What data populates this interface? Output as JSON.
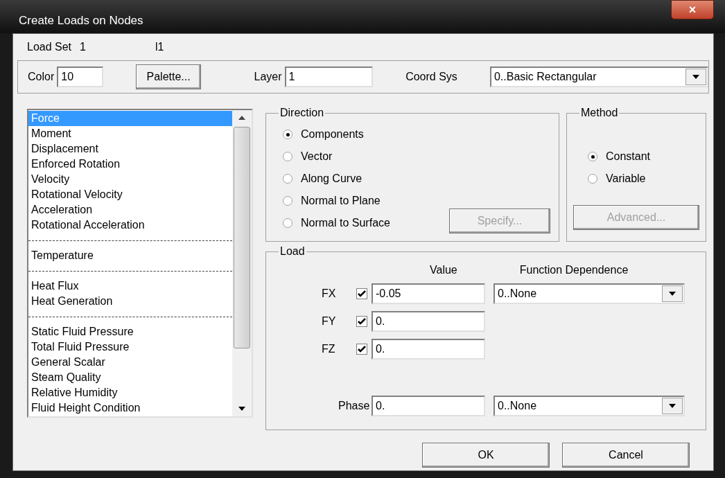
{
  "window": {
    "title": "Create Loads on Nodes",
    "close": "×"
  },
  "load_set": {
    "label": "Load Set",
    "number": "1",
    "name": "l1"
  },
  "top": {
    "color_label": "Color",
    "color_value": "10",
    "palette_button": "Palette...",
    "layer_label": "Layer",
    "layer_value": "1",
    "coord_label": "Coord Sys",
    "coord_value": "0..Basic Rectangular"
  },
  "load_types": [
    {
      "kind": "item",
      "label": "Force",
      "selected": true
    },
    {
      "kind": "item",
      "label": "Moment",
      "selected": false
    },
    {
      "kind": "item",
      "label": "Displacement",
      "selected": false
    },
    {
      "kind": "item",
      "label": "Enforced Rotation",
      "selected": false
    },
    {
      "kind": "item",
      "label": "Velocity",
      "selected": false
    },
    {
      "kind": "item",
      "label": "Rotational Velocity",
      "selected": false
    },
    {
      "kind": "item",
      "label": "Acceleration",
      "selected": false
    },
    {
      "kind": "item",
      "label": "Rotational Acceleration",
      "selected": false
    },
    {
      "kind": "separator"
    },
    {
      "kind": "item",
      "label": "Temperature",
      "selected": false
    },
    {
      "kind": "separator"
    },
    {
      "kind": "item",
      "label": "Heat Flux",
      "selected": false
    },
    {
      "kind": "item",
      "label": "Heat Generation",
      "selected": false
    },
    {
      "kind": "separator"
    },
    {
      "kind": "item",
      "label": "Static Fluid Pressure",
      "selected": false
    },
    {
      "kind": "item",
      "label": "Total Fluid Pressure",
      "selected": false
    },
    {
      "kind": "item",
      "label": "General Scalar",
      "selected": false
    },
    {
      "kind": "item",
      "label": "Steam Quality",
      "selected": false
    },
    {
      "kind": "item",
      "label": "Relative Humidity",
      "selected": false
    },
    {
      "kind": "item",
      "label": "Fluid Height Condition",
      "selected": false
    }
  ],
  "direction": {
    "title": "Direction",
    "options": [
      {
        "label": "Components",
        "selected": true
      },
      {
        "label": "Vector",
        "selected": false
      },
      {
        "label": "Along Curve",
        "selected": false
      },
      {
        "label": "Normal to Plane",
        "selected": false
      },
      {
        "label": "Normal to Surface",
        "selected": false
      }
    ],
    "specify_button": {
      "label": "Specify...",
      "disabled": true
    }
  },
  "method": {
    "title": "Method",
    "options": [
      {
        "label": "Constant",
        "selected": true
      },
      {
        "label": "Variable",
        "selected": false
      }
    ],
    "advanced_button": {
      "label": "Advanced...",
      "disabled": true
    }
  },
  "load": {
    "title": "Load",
    "value_header": "Value",
    "function_header": "Function Dependence",
    "rows": [
      {
        "label": "FX",
        "checked": true,
        "value": "-0.05",
        "function": "0..None"
      },
      {
        "label": "FY",
        "checked": true,
        "value": "0."
      },
      {
        "label": "FZ",
        "checked": true,
        "value": "0."
      }
    ],
    "phase": {
      "label": "Phase",
      "value": "0.",
      "function": "0..None"
    }
  },
  "buttons": [
    {
      "label": "OK",
      "disabled": false
    },
    {
      "label": "Cancel",
      "disabled": false
    }
  ]
}
